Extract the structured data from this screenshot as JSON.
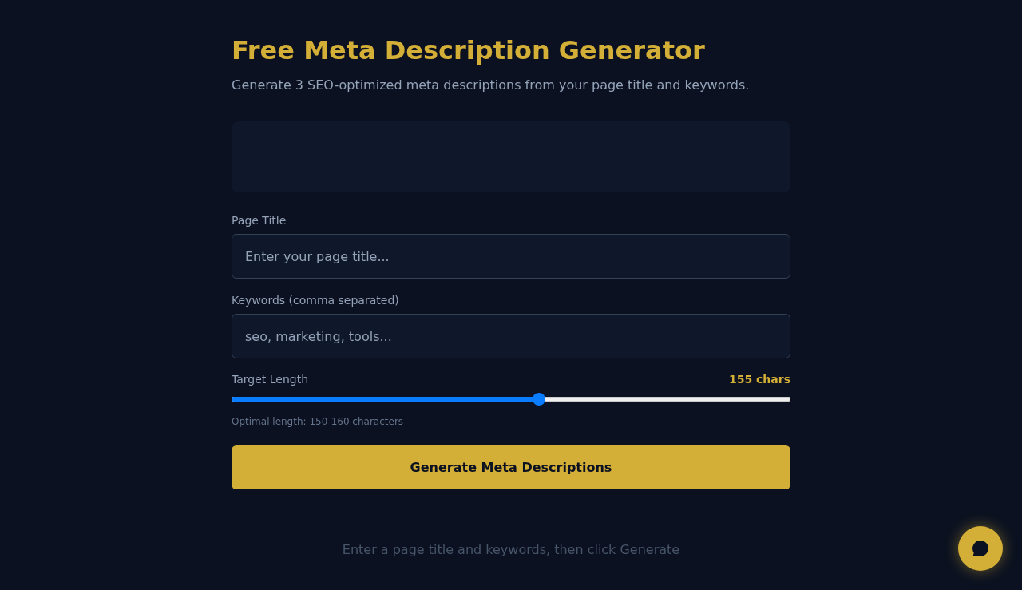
{
  "header": {
    "title": "Free Meta Description Generator",
    "subtitle": "Generate 3 SEO-optimized meta descriptions from your page title and keywords."
  },
  "form": {
    "fields": [
      {
        "label": "Page Title",
        "placeholder": "Enter your page title..."
      },
      {
        "label": "Keywords (comma separated)",
        "placeholder": "seo, marketing, tools..."
      }
    ],
    "target_length": {
      "label": "Target Length",
      "reading": "155 chars",
      "level": 0.55,
      "hint": "Optimal length: 150-160 characters"
    },
    "submit_button": "Generate Meta Descriptions"
  },
  "empty_state": "Enter a page title and keywords, then click Generate"
}
